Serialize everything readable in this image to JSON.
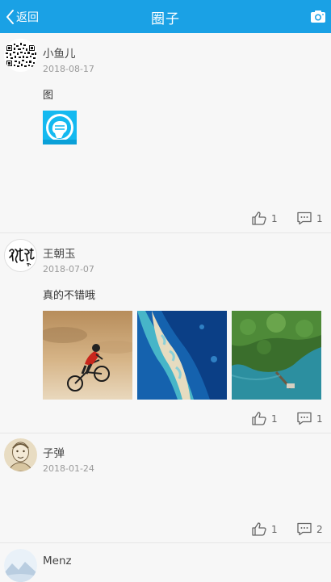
{
  "header": {
    "back_label": "返回",
    "title": "圈子"
  },
  "posts": [
    {
      "name": "小鱼儿",
      "date": "2018-08-17",
      "text": "图",
      "likes": "1",
      "comments": "1"
    },
    {
      "name": "王朝玉",
      "date": "2018-07-07",
      "text": "真的不错哦",
      "likes": "1",
      "comments": "1"
    },
    {
      "name": "子弹",
      "date": "2018-01-24",
      "text": "",
      "likes": "1",
      "comments": "2"
    },
    {
      "name": "Menz"
    }
  ],
  "colors": {
    "header_bg": "#1aa1e5",
    "page_bg": "#f7f7f7"
  }
}
